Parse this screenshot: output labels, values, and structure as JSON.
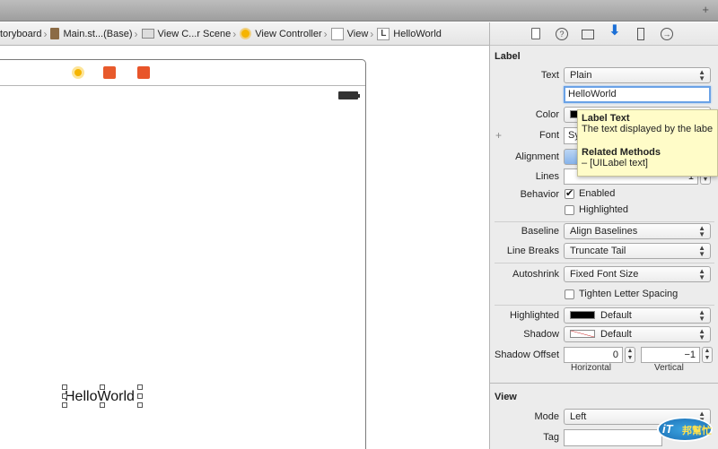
{
  "breadcrumbs": [
    {
      "label": "toryboard",
      "icon": "none"
    },
    {
      "label": "Main.st...(Base)",
      "icon": "storyboard-file-icon"
    },
    {
      "label": "View C...r Scene",
      "icon": "scene-icon"
    },
    {
      "label": "View Controller",
      "icon": "view-controller-icon"
    },
    {
      "label": "View",
      "icon": "view-icon"
    },
    {
      "label": "HelloWorld",
      "icon": "label-icon"
    }
  ],
  "canvas": {
    "label_text": "HelloWorld"
  },
  "inspector": {
    "label_section": {
      "title": "Label",
      "text_label": "Text",
      "text_type": "Plain",
      "text_value": "HelloWorld",
      "color_label": "Color",
      "font_label": "Font",
      "font_value": "Sy",
      "alignment_label": "Alignment",
      "lines_label": "Lines",
      "lines_value": "1",
      "behavior_label": "Behavior",
      "enabled_label": "Enabled",
      "highlighted_check_label": "Highlighted",
      "baseline_label": "Baseline",
      "baseline_value": "Align Baselines",
      "line_breaks_label": "Line Breaks",
      "line_breaks_value": "Truncate Tail",
      "autoshrink_label": "Autoshrink",
      "autoshrink_value": "Fixed Font Size",
      "tighten_label": "Tighten Letter Spacing",
      "highlighted_label": "Highlighted",
      "highlighted_value": "Default",
      "shadow_label": "Shadow",
      "shadow_value": "Default",
      "shadow_offset_label": "Shadow Offset",
      "shadow_h_value": "0",
      "shadow_v_value": "−1",
      "horizontal_label": "Horizontal",
      "vertical_label": "Vertical"
    },
    "view_section": {
      "title": "View",
      "mode_label": "Mode",
      "mode_value": "Left",
      "tag_label": "Tag"
    }
  },
  "tooltip": {
    "title": "Label Text",
    "description": "The text displayed by the labe",
    "methods_title": "Related Methods",
    "method": "– [UILabel text]"
  },
  "watermark": {
    "text_it": "iT",
    "text_cn": "邦幫忙"
  },
  "colors": {
    "accent": "#1b6fd6",
    "focus_ring": "#6aa2e6",
    "tooltip_bg": "#fffcc8"
  }
}
